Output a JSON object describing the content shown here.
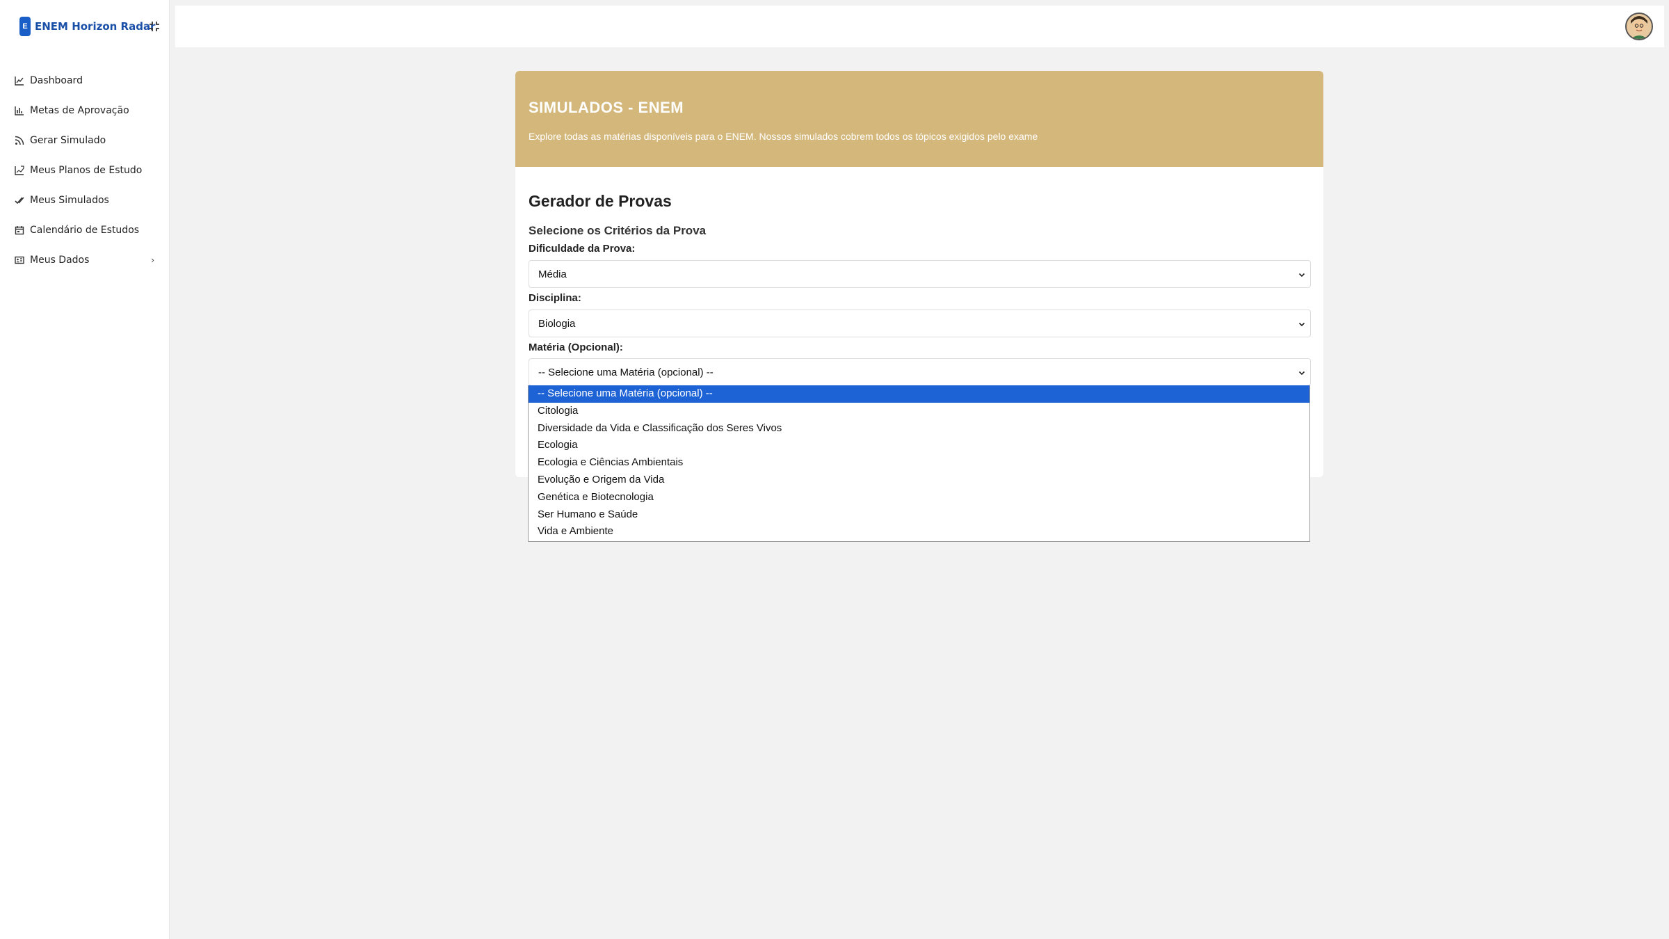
{
  "brand": {
    "badge": "E",
    "name": "ENEM Horizon Radar"
  },
  "sidebar": {
    "items": [
      {
        "label": "Dashboard",
        "icon": "chart-line-icon"
      },
      {
        "label": "Metas de Aprovação",
        "icon": "bar-chart-icon"
      },
      {
        "label": "Gerar Simulado",
        "icon": "rss-icon"
      },
      {
        "label": "Meus Planos de Estudo",
        "icon": "chart-grid-icon"
      },
      {
        "label": "Meus Simulados",
        "icon": "double-check-icon"
      },
      {
        "label": "Calendário de Estudos",
        "icon": "calendar-icon"
      },
      {
        "label": "Meus Dados",
        "icon": "id-card-icon",
        "has_submenu": true
      }
    ]
  },
  "hero": {
    "title": "SIMULADOS - ENEM",
    "subtitle": "Explore todas as matérias disponíveis para o ENEM. Nossos simulados cobrem todos os tópicos exigidos pelo exame"
  },
  "form": {
    "title": "Gerador de Provas",
    "subtitle": "Selecione os Critérios da Prova",
    "difficulty": {
      "label": "Dificuldade da Prova:",
      "value": "Média"
    },
    "discipline": {
      "label": "Disciplina:",
      "value": "Biologia"
    },
    "subject": {
      "label": "Matéria (Opcional):",
      "value": "-- Selecione uma Matéria (opcional) --",
      "options": [
        "-- Selecione uma Matéria (opcional) --",
        "Citologia",
        "Diversidade da Vida e Classificação dos Seres Vivos",
        "Ecologia",
        "Ecologia e Ciências Ambientais",
        "Evolução e Origem da Vida",
        "Genética e Biotecnologia",
        "Ser Humano e Saúde",
        "Vida e Ambiente"
      ],
      "highlighted_index": 0
    }
  },
  "colors": {
    "brand_blue": "#1a4fa8",
    "hero_gold": "#d3b77b",
    "highlight_blue": "#1e63d6"
  }
}
